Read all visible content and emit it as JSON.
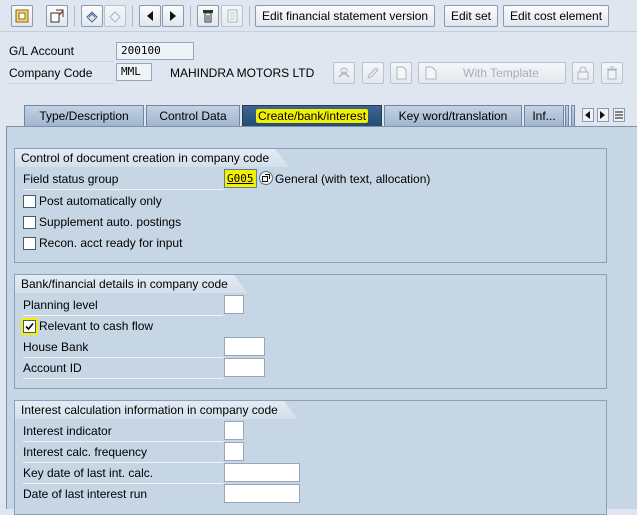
{
  "toolbar": {
    "icons": [
      "create-icon",
      "display-change-icon",
      "copy-icon",
      "refresh-icon",
      "previous-icon",
      "next-icon",
      "print-icon",
      "notes-icon"
    ],
    "edit_fs_version_label": "Edit financial statement version",
    "edit_set_label": "Edit set",
    "edit_cost_element_label": "Edit cost element"
  },
  "header": {
    "gl_account_label": "G/L Account",
    "gl_account_value": "200100",
    "company_code_label": "Company Code",
    "company_code_value": "MML",
    "company_name": "MAHINDRA MOTORS LTD",
    "with_template_label": "With Template"
  },
  "tabs": [
    {
      "label": "Type/Description",
      "active": false
    },
    {
      "label": "Control Data",
      "active": false
    },
    {
      "label": "Create/bank/interest",
      "active": true
    },
    {
      "label": "Key word/translation",
      "active": false
    },
    {
      "label": "Inf...",
      "active": false
    }
  ],
  "groups": {
    "doc_creation": {
      "title": "Control of document creation in company code",
      "field_status_group_label": "Field status group",
      "field_status_group_value": "G005",
      "field_status_group_text": "General (with text, allocation)",
      "post_automatically_label": "Post automatically only",
      "post_automatically_checked": false,
      "supplement_auto_label": "Supplement auto. postings",
      "supplement_auto_checked": false,
      "recon_acct_label": "Recon. acct ready for input",
      "recon_acct_checked": false
    },
    "bank": {
      "title": "Bank/financial details in company code",
      "planning_level_label": "Planning level",
      "planning_level_value": "",
      "cash_flow_label": "Relevant to cash flow",
      "cash_flow_checked": true,
      "house_bank_label": "House Bank",
      "house_bank_value": "",
      "account_id_label": "Account ID",
      "account_id_value": ""
    },
    "interest": {
      "title": "Interest calculation information in company code",
      "indicator_label": "Interest indicator",
      "indicator_value": "",
      "frequency_label": "Interest calc. frequency",
      "frequency_value": "",
      "key_date_label": "Key date of last int. calc.",
      "key_date_value": "",
      "last_run_label": "Date of last interest run",
      "last_run_value": ""
    }
  },
  "colors": {
    "highlight": "#f3f000",
    "active_tab": "#2d5580",
    "panel": "#c6d6e5"
  }
}
